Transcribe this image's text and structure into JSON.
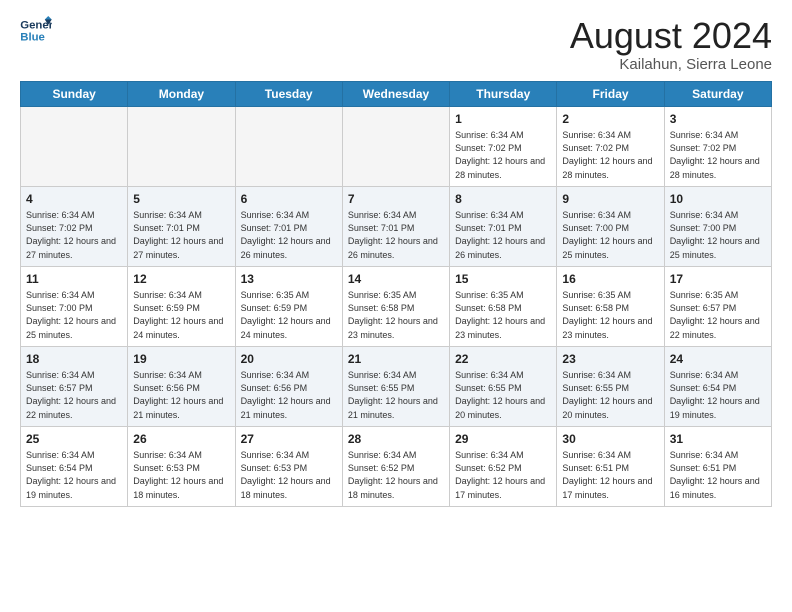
{
  "header": {
    "logo_line1": "General",
    "logo_line2": "Blue",
    "month": "August 2024",
    "location": "Kailahun, Sierra Leone"
  },
  "weekdays": [
    "Sunday",
    "Monday",
    "Tuesday",
    "Wednesday",
    "Thursday",
    "Friday",
    "Saturday"
  ],
  "weeks": [
    [
      {
        "day": "",
        "sunrise": "",
        "sunset": "",
        "daylight": ""
      },
      {
        "day": "",
        "sunrise": "",
        "sunset": "",
        "daylight": ""
      },
      {
        "day": "",
        "sunrise": "",
        "sunset": "",
        "daylight": ""
      },
      {
        "day": "",
        "sunrise": "",
        "sunset": "",
        "daylight": ""
      },
      {
        "day": "1",
        "sunrise": "Sunrise: 6:34 AM",
        "sunset": "Sunset: 7:02 PM",
        "daylight": "Daylight: 12 hours and 28 minutes."
      },
      {
        "day": "2",
        "sunrise": "Sunrise: 6:34 AM",
        "sunset": "Sunset: 7:02 PM",
        "daylight": "Daylight: 12 hours and 28 minutes."
      },
      {
        "day": "3",
        "sunrise": "Sunrise: 6:34 AM",
        "sunset": "Sunset: 7:02 PM",
        "daylight": "Daylight: 12 hours and 28 minutes."
      }
    ],
    [
      {
        "day": "4",
        "sunrise": "Sunrise: 6:34 AM",
        "sunset": "Sunset: 7:02 PM",
        "daylight": "Daylight: 12 hours and 27 minutes."
      },
      {
        "day": "5",
        "sunrise": "Sunrise: 6:34 AM",
        "sunset": "Sunset: 7:01 PM",
        "daylight": "Daylight: 12 hours and 27 minutes."
      },
      {
        "day": "6",
        "sunrise": "Sunrise: 6:34 AM",
        "sunset": "Sunset: 7:01 PM",
        "daylight": "Daylight: 12 hours and 26 minutes."
      },
      {
        "day": "7",
        "sunrise": "Sunrise: 6:34 AM",
        "sunset": "Sunset: 7:01 PM",
        "daylight": "Daylight: 12 hours and 26 minutes."
      },
      {
        "day": "8",
        "sunrise": "Sunrise: 6:34 AM",
        "sunset": "Sunset: 7:01 PM",
        "daylight": "Daylight: 12 hours and 26 minutes."
      },
      {
        "day": "9",
        "sunrise": "Sunrise: 6:34 AM",
        "sunset": "Sunset: 7:00 PM",
        "daylight": "Daylight: 12 hours and 25 minutes."
      },
      {
        "day": "10",
        "sunrise": "Sunrise: 6:34 AM",
        "sunset": "Sunset: 7:00 PM",
        "daylight": "Daylight: 12 hours and 25 minutes."
      }
    ],
    [
      {
        "day": "11",
        "sunrise": "Sunrise: 6:34 AM",
        "sunset": "Sunset: 7:00 PM",
        "daylight": "Daylight: 12 hours and 25 minutes."
      },
      {
        "day": "12",
        "sunrise": "Sunrise: 6:34 AM",
        "sunset": "Sunset: 6:59 PM",
        "daylight": "Daylight: 12 hours and 24 minutes."
      },
      {
        "day": "13",
        "sunrise": "Sunrise: 6:35 AM",
        "sunset": "Sunset: 6:59 PM",
        "daylight": "Daylight: 12 hours and 24 minutes."
      },
      {
        "day": "14",
        "sunrise": "Sunrise: 6:35 AM",
        "sunset": "Sunset: 6:58 PM",
        "daylight": "Daylight: 12 hours and 23 minutes."
      },
      {
        "day": "15",
        "sunrise": "Sunrise: 6:35 AM",
        "sunset": "Sunset: 6:58 PM",
        "daylight": "Daylight: 12 hours and 23 minutes."
      },
      {
        "day": "16",
        "sunrise": "Sunrise: 6:35 AM",
        "sunset": "Sunset: 6:58 PM",
        "daylight": "Daylight: 12 hours and 23 minutes."
      },
      {
        "day": "17",
        "sunrise": "Sunrise: 6:35 AM",
        "sunset": "Sunset: 6:57 PM",
        "daylight": "Daylight: 12 hours and 22 minutes."
      }
    ],
    [
      {
        "day": "18",
        "sunrise": "Sunrise: 6:34 AM",
        "sunset": "Sunset: 6:57 PM",
        "daylight": "Daylight: 12 hours and 22 minutes."
      },
      {
        "day": "19",
        "sunrise": "Sunrise: 6:34 AM",
        "sunset": "Sunset: 6:56 PM",
        "daylight": "Daylight: 12 hours and 21 minutes."
      },
      {
        "day": "20",
        "sunrise": "Sunrise: 6:34 AM",
        "sunset": "Sunset: 6:56 PM",
        "daylight": "Daylight: 12 hours and 21 minutes."
      },
      {
        "day": "21",
        "sunrise": "Sunrise: 6:34 AM",
        "sunset": "Sunset: 6:55 PM",
        "daylight": "Daylight: 12 hours and 21 minutes."
      },
      {
        "day": "22",
        "sunrise": "Sunrise: 6:34 AM",
        "sunset": "Sunset: 6:55 PM",
        "daylight": "Daylight: 12 hours and 20 minutes."
      },
      {
        "day": "23",
        "sunrise": "Sunrise: 6:34 AM",
        "sunset": "Sunset: 6:55 PM",
        "daylight": "Daylight: 12 hours and 20 minutes."
      },
      {
        "day": "24",
        "sunrise": "Sunrise: 6:34 AM",
        "sunset": "Sunset: 6:54 PM",
        "daylight": "Daylight: 12 hours and 19 minutes."
      }
    ],
    [
      {
        "day": "25",
        "sunrise": "Sunrise: 6:34 AM",
        "sunset": "Sunset: 6:54 PM",
        "daylight": "Daylight: 12 hours and 19 minutes."
      },
      {
        "day": "26",
        "sunrise": "Sunrise: 6:34 AM",
        "sunset": "Sunset: 6:53 PM",
        "daylight": "Daylight: 12 hours and 18 minutes."
      },
      {
        "day": "27",
        "sunrise": "Sunrise: 6:34 AM",
        "sunset": "Sunset: 6:53 PM",
        "daylight": "Daylight: 12 hours and 18 minutes."
      },
      {
        "day": "28",
        "sunrise": "Sunrise: 6:34 AM",
        "sunset": "Sunset: 6:52 PM",
        "daylight": "Daylight: 12 hours and 18 minutes."
      },
      {
        "day": "29",
        "sunrise": "Sunrise: 6:34 AM",
        "sunset": "Sunset: 6:52 PM",
        "daylight": "Daylight: 12 hours and 17 minutes."
      },
      {
        "day": "30",
        "sunrise": "Sunrise: 6:34 AM",
        "sunset": "Sunset: 6:51 PM",
        "daylight": "Daylight: 12 hours and 17 minutes."
      },
      {
        "day": "31",
        "sunrise": "Sunrise: 6:34 AM",
        "sunset": "Sunset: 6:51 PM",
        "daylight": "Daylight: 12 hours and 16 minutes."
      }
    ]
  ]
}
